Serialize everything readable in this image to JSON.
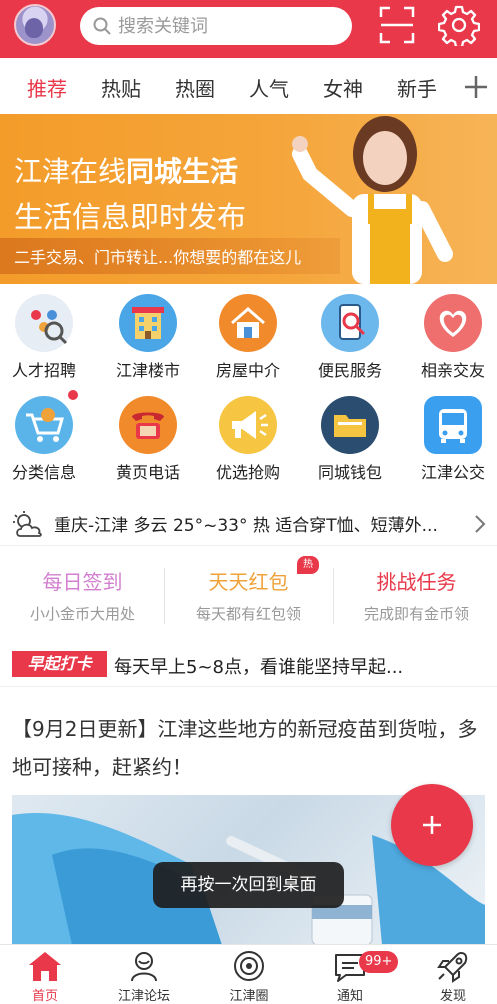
{
  "header": {
    "search_placeholder": "搜索关键词"
  },
  "tabs": [
    {
      "label": "推荐",
      "active": true
    },
    {
      "label": "热贴",
      "active": false
    },
    {
      "label": "热圈",
      "active": false
    },
    {
      "label": "人气",
      "active": false
    },
    {
      "label": "女神",
      "active": false
    },
    {
      "label": "新手",
      "active": false
    }
  ],
  "banner": {
    "line1_prefix": "江津在线",
    "line1_bold": "同城生活",
    "line2": "生活信息即时发布",
    "line3": "二手交易、门市转让...你想要的都在这儿"
  },
  "grid": [
    {
      "label": "人才招聘",
      "icon": "recruit-icon"
    },
    {
      "label": "江津楼市",
      "icon": "building-icon"
    },
    {
      "label": "房屋中介",
      "icon": "house-icon"
    },
    {
      "label": "便民服务",
      "icon": "phone-search-icon"
    },
    {
      "label": "相亲交友",
      "icon": "heart-icon"
    },
    {
      "label": "分类信息",
      "icon": "cart-icon"
    },
    {
      "label": "黄页电话",
      "icon": "telephone-icon"
    },
    {
      "label": "优选抢购",
      "icon": "megaphone-icon"
    },
    {
      "label": "同城钱包",
      "icon": "folder-icon"
    },
    {
      "label": "江津公交",
      "icon": "bus-icon"
    }
  ],
  "weather": {
    "text": "重庆-江津 多云 25°~33° 热 适合穿T恤、短薄外..."
  },
  "tasks": [
    {
      "title": "每日签到",
      "sub": "小小金币大用处",
      "color": "#d37fd0"
    },
    {
      "title": "天天红包",
      "sub": "每天都有红包领",
      "color": "#f0a23a",
      "badge": "热"
    },
    {
      "title": "挑战任务",
      "sub": "完成即有金币领",
      "color": "#e8384a"
    }
  ],
  "early": {
    "badge": "早起打卡",
    "text": "每天早上5~8点，看谁能坚持早起..."
  },
  "article": {
    "title": "【9月2日更新】江津这些地方的新冠疫苗到货啦，多地可接种，赶紧约！"
  },
  "toast": "再按一次回到桌面",
  "bottom_nav": [
    {
      "label": "首页",
      "active": true
    },
    {
      "label": "江津论坛",
      "active": false
    },
    {
      "label": "江津圈",
      "active": false
    },
    {
      "label": "通知",
      "active": false,
      "badge": "99+"
    },
    {
      "label": "发现",
      "active": false
    }
  ],
  "colors": {
    "accent": "#e8384a",
    "banner": "#f39c2a"
  }
}
